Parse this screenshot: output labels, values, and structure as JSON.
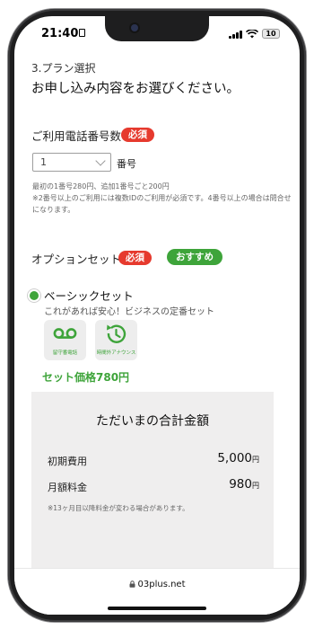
{
  "status_bar": {
    "time": "21:40",
    "battery": "10"
  },
  "page": {
    "section_label": "3.プラン選択",
    "headline": "お申し込み内容をお選びください。"
  },
  "phone_count": {
    "label": "ご利用電話番号数",
    "required_badge": "必須",
    "select_value": "1",
    "unit": "番号",
    "note_1": "最初の1番号280円、追加1番号ごと200円",
    "note_2": "※2番号以上のご利用には複数IDのご利用が必須です。4番号以上の場合は問合せ",
    "note_3": "になります。"
  },
  "option_set": {
    "label": "オプションセット",
    "required_badge": "必須",
    "recommend_badge": "おすすめ",
    "plan_name": "ベーシックセット",
    "plan_desc": "これがあれば安心！ビジネスの定番セット",
    "features": [
      {
        "icon": "voicemail-icon",
        "caption": "留守番電話"
      },
      {
        "icon": "clock-announcement-icon",
        "caption": "時間外アナウンス"
      }
    ],
    "set_price": "セット価格780円"
  },
  "total": {
    "title": "ただいまの合計金額",
    "initial_label": "初期費用",
    "initial_value": "5,000",
    "monthly_label": "月額料金",
    "monthly_value": "980",
    "yen": "円",
    "note": "※13ヶ月目以降料金が変わる場合があります。"
  },
  "browser": {
    "url": "03plus.net"
  },
  "colors": {
    "accent_green": "#3ea43a",
    "required_red": "#e63a2e",
    "total_bg": "#efeeee"
  }
}
